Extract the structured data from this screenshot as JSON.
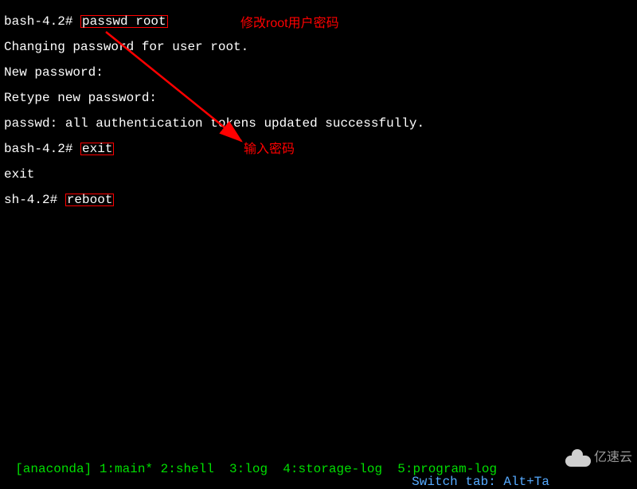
{
  "terminal": {
    "lines": [
      {
        "prompt": "bash-4.2# ",
        "cmd": "passwd root",
        "boxed": true
      },
      {
        "text": "Changing password for user root."
      },
      {
        "text": "New password:"
      },
      {
        "text": "Retype new password:"
      },
      {
        "text": "passwd: all authentication tokens updated successfully."
      },
      {
        "prompt": "bash-4.2# ",
        "cmd": "exit",
        "boxed": true
      },
      {
        "text": "exit"
      },
      {
        "prompt": "sh-4.2# ",
        "cmd": "reboot",
        "boxed": true
      }
    ]
  },
  "annotations": {
    "title": "修改root用户密码",
    "input_password": "输入密码"
  },
  "statusbar": {
    "left": "[anaconda] 1:main* 2:shell  3:log  4:storage-log  5:program-log",
    "right": "Switch tab: Alt+Ta"
  },
  "watermark": {
    "text": "亿速云"
  }
}
